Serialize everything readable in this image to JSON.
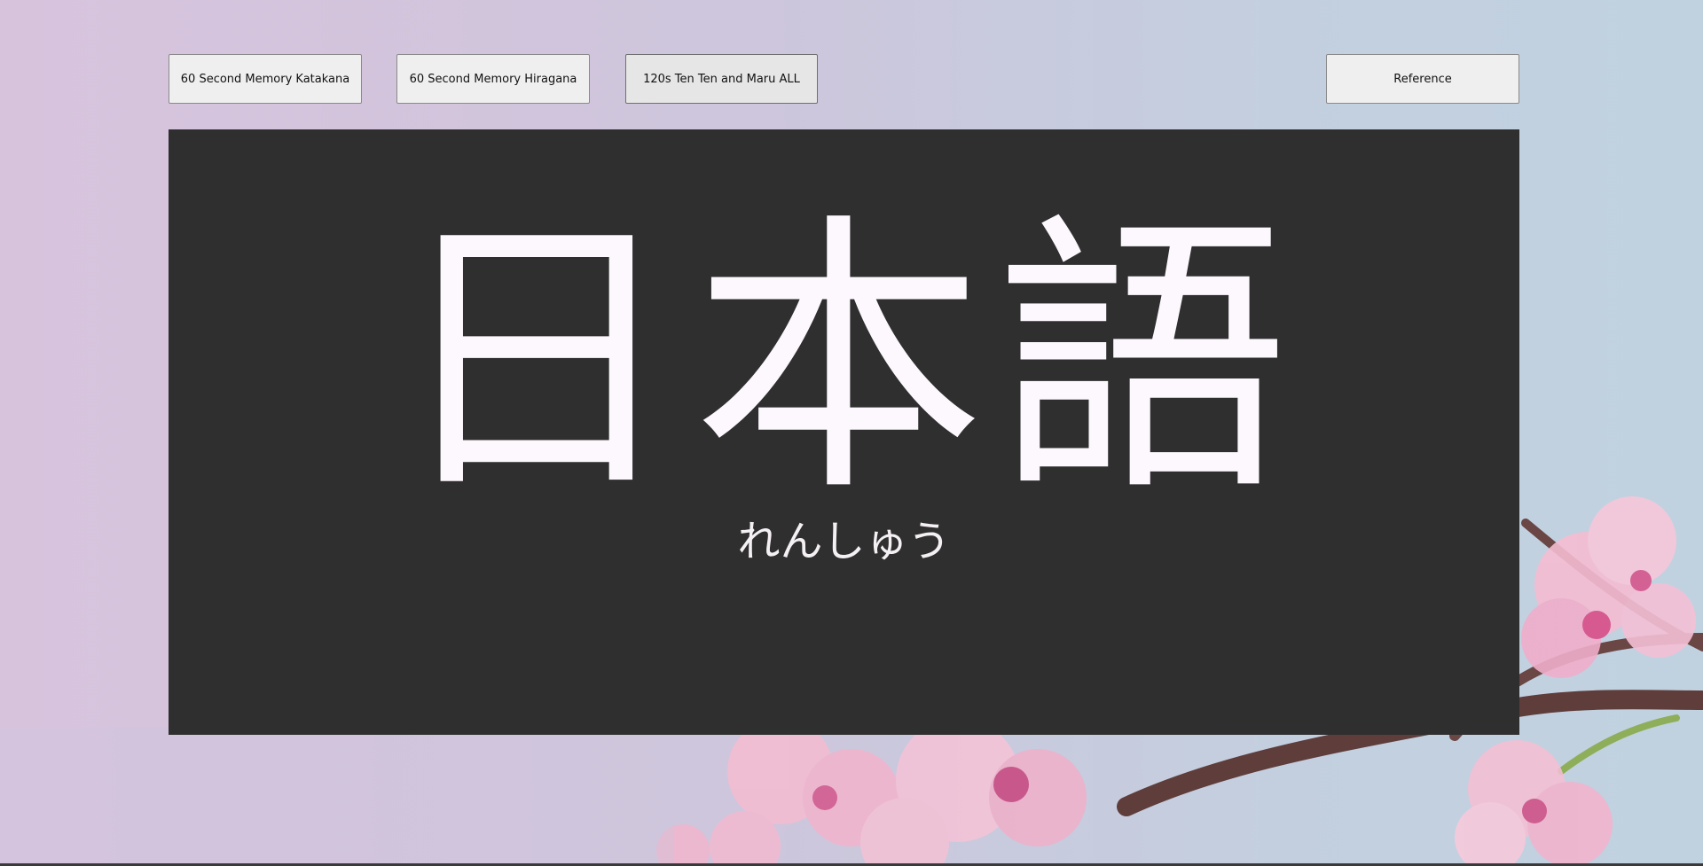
{
  "modes": {
    "katakana_label": "60 Second Memory Katakana",
    "hiragana_label": "60 Second Memory Hiragana",
    "tenten_label": "120s Ten Ten and Maru ALL"
  },
  "reference_label": "Reference",
  "display": {
    "title": "日本語",
    "subtitle": "れんしゅう"
  },
  "background": {
    "image": "cherry-blossom-branch",
    "colors": {
      "gradient_left": "#d8c3dd",
      "gradient_right": "#c0d2e0",
      "panel": "#2f2f2f",
      "text": "#fdf8fd",
      "blossom": "#f2b7cf",
      "branch": "#5e3d3b"
    }
  }
}
